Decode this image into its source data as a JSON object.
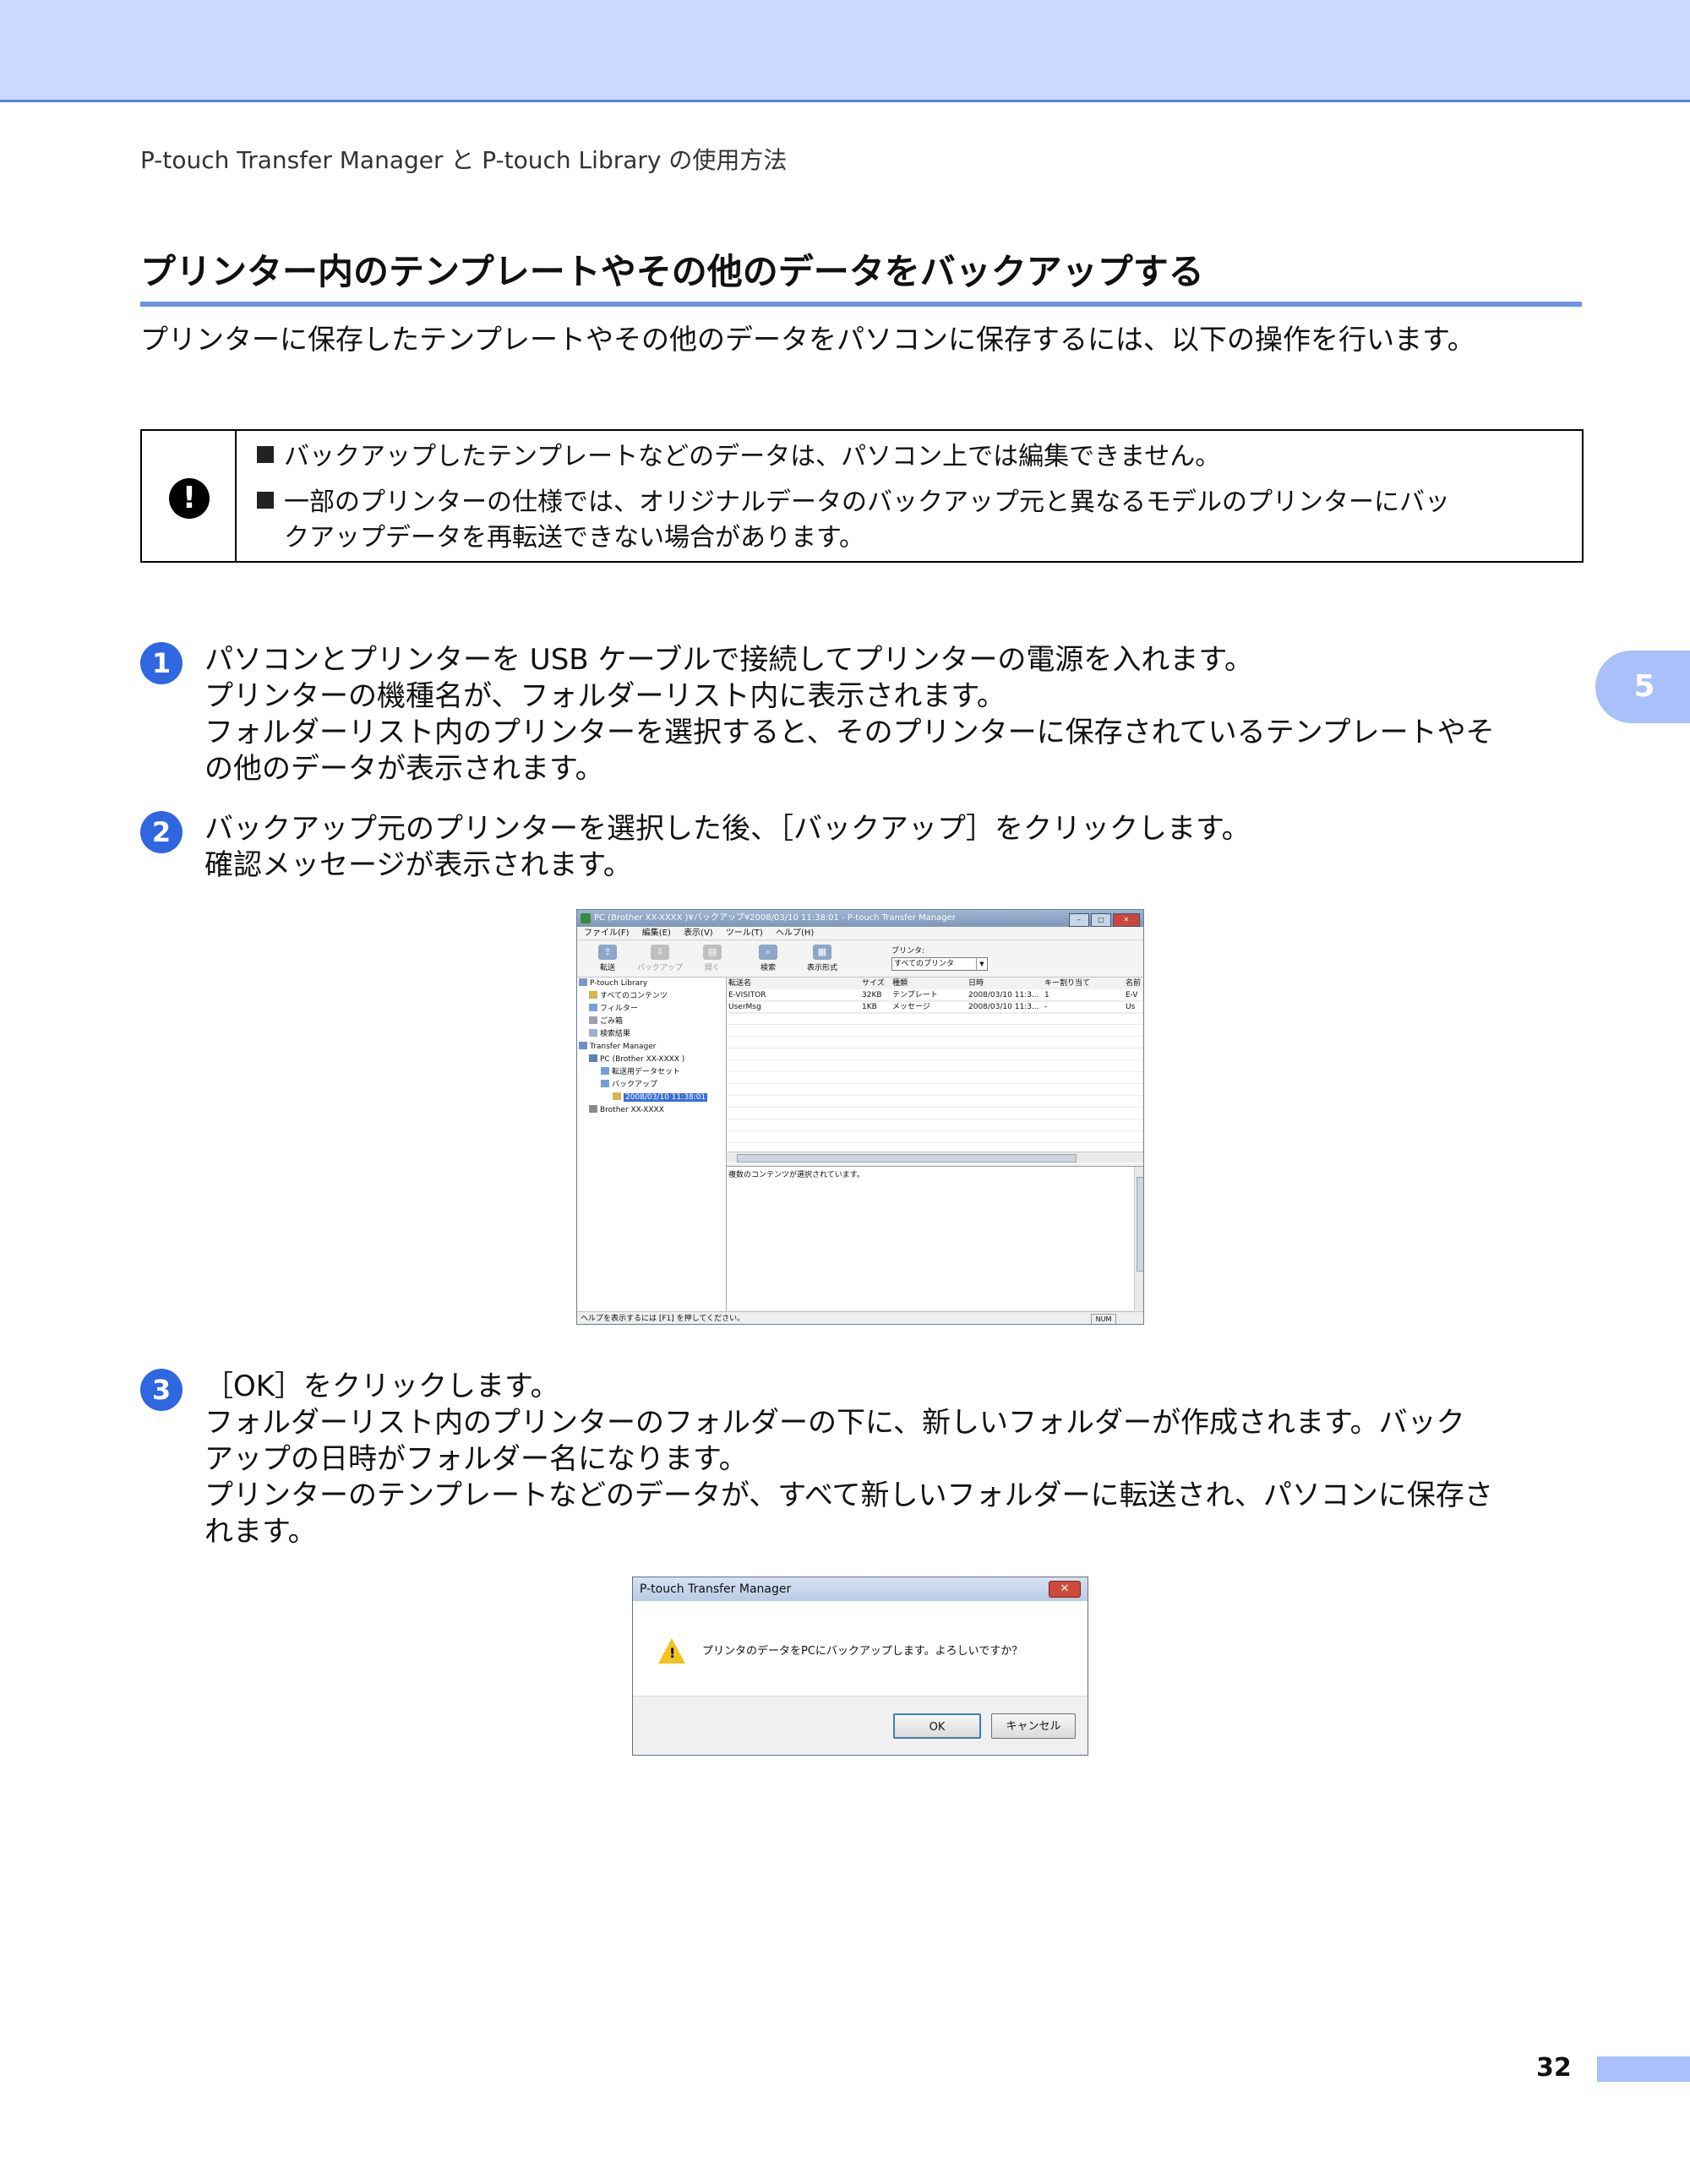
{
  "header": {
    "breadcrumb": "P-touch Transfer Manager と P-touch Library の使用方法"
  },
  "section": {
    "title": "プリンター内のテンプレートやその他のデータをバックアップする",
    "intro": "プリンターに保存したテンプレートやその他のデータをパソコンに保存するには、以下の操作を行います。"
  },
  "note": {
    "icon": "!",
    "items": [
      "バックアップしたテンプレートなどのデータは、パソコン上では編集できません。",
      "一部のプリンターの仕様では、オリジナルデータのバックアップ元と異なるモデルのプリンターにバッ",
      "クアップデータを再転送できない場合があります。"
    ]
  },
  "steps": [
    {
      "num": "1",
      "lines": [
        "パソコンとプリンターを USB ケーブルで接続してプリンターの電源を入れます。",
        "プリンターの機種名が、フォルダーリスト内に表示されます。",
        "フォルダーリスト内のプリンターを選択すると、そのプリンターに保存されているテンプレートやそ",
        "の他のデータが表示されます。"
      ]
    },
    {
      "num": "2",
      "lines": [
        "バックアップ元のプリンターを選択した後、［バックアップ］をクリックします。",
        "確認メッセージが表示されます。"
      ]
    },
    {
      "num": "3",
      "lines": [
        "［OK］をクリックします。",
        "フォルダーリスト内のプリンターのフォルダーの下に、新しいフォルダーが作成されます。バック",
        "アップの日時がフォルダー名になります。",
        "プリンターのテンプレートなどのデータが、すべて新しいフォルダーに転送され、パソコンに保存さ",
        "れます。"
      ]
    }
  ],
  "chapter_tab": "5",
  "page_number": "32",
  "app": {
    "title": "PC (Brother XX-XXXX )¥バックアップ¥2008/03/10 11:38:01 - P-touch Transfer Manager",
    "menu": [
      "ファイル(F)",
      "編集(E)",
      "表示(V)",
      "ツール(T)",
      "ヘルプ(H)"
    ],
    "toolbar": {
      "transfer": "転送",
      "backup": "バックアップ",
      "open": "開く",
      "search": "検索",
      "view": "表示形式",
      "printer_label": "プリンタ:",
      "printer_value": "すべてのプリンタ"
    },
    "tree": [
      "P-touch Library",
      "すべてのコンテンツ",
      "フィルター",
      "ごみ箱",
      "検索結果",
      "Transfer Manager",
      "PC (Brother XX-XXXX )",
      "転送用データセット",
      "バックアップ",
      "2008/03/10 11:38:01",
      "Brother XX-XXXX"
    ],
    "columns": [
      "転送名",
      "サイズ",
      "種類",
      "日時",
      "キー割り当て",
      "名前"
    ],
    "rows": [
      [
        "E-VISITOR",
        "32KB",
        "テンプレート",
        "2008/03/10 11:3...",
        "1",
        "E-V"
      ],
      [
        "UserMsg",
        "1KB",
        "メッセージ",
        "2008/03/10 11:3...",
        "-",
        "Us"
      ]
    ],
    "preview_text": "複数のコンテンツが選択されています。",
    "status_text": "ヘルプを表示するには [F1] を押してください。",
    "status_num": "NUM"
  },
  "dialog": {
    "title": "P-touch Transfer Manager",
    "message": "プリンタのデータをPCにバックアップします。よろしいですか？",
    "ok": "OK",
    "cancel": "キャンセル"
  }
}
